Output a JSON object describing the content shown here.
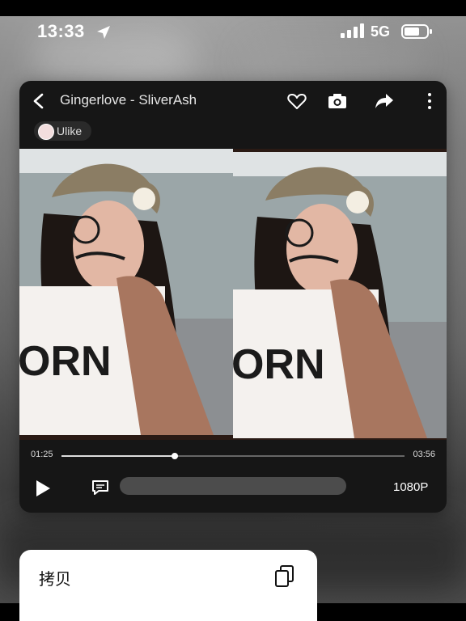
{
  "status": {
    "time": "13:33",
    "network": "5G"
  },
  "player": {
    "title": "Gingerlove - SliverAsh",
    "chip": "Ulike",
    "current_time": "01:25",
    "total_time": "03:56",
    "progress": 0.33,
    "quality": "1080P"
  },
  "menu": {
    "copy_label": "拷贝"
  },
  "colors": {
    "player_bg": "#161616",
    "chip_bg": "#2a2a2a",
    "danmaku_input_bg": "#4c4c4c"
  }
}
